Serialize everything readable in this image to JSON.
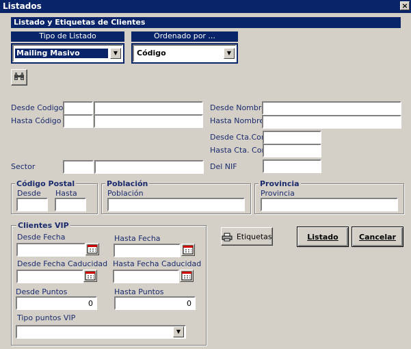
{
  "window": {
    "title": "Listados",
    "close_glyph": "×"
  },
  "header": {
    "title": "Listado y Etiquetas de Clientes"
  },
  "tipo_listado": {
    "label": "Tipo de Listado",
    "value": "Mailing Masivo"
  },
  "ordenado_por": {
    "label": "Ordenado por ...",
    "value": "Código"
  },
  "search_icon": "binoculars-icon",
  "filters": {
    "desde_codigo": "Desde Codigo",
    "hasta_codigo": "Hasta Código",
    "sector": "Sector",
    "desde_nombre": "Desde Nombre",
    "hasta_nombre": "Hasta Nombre",
    "desde_cta": "Desde Cta.Cont.",
    "hasta_cta": "Hasta Cta. Cont.",
    "del_nif": "Del NIF"
  },
  "codigo_postal": {
    "title": "Código Postal",
    "desde": "Desde",
    "hasta": "Hasta"
  },
  "poblacion": {
    "title": "Población",
    "label": "Población"
  },
  "provincia": {
    "title": "Provincia",
    "label": "Provincia"
  },
  "vip": {
    "title": "Clientes VIP",
    "desde_fecha": "Desde Fecha",
    "hasta_fecha": "Hasta Fecha",
    "desde_fecha_cad": "Desde Fecha Caducidad",
    "hasta_fecha_cad": "Hasta Fecha Caducidad",
    "desde_puntos": "Desde Puntos",
    "hasta_puntos": "Hasta Puntos",
    "desde_puntos_val": "0",
    "hasta_puntos_val": "0",
    "tipo_puntos": "Tipo puntos VIP"
  },
  "buttons": {
    "etiquetas": "Etiquetas",
    "listado": "Listado",
    "cancelar": "Cancelar"
  },
  "colors": {
    "title_blue": "#0a246a",
    "face": "#d4d0c8",
    "label_text": "#1a2a6c"
  }
}
